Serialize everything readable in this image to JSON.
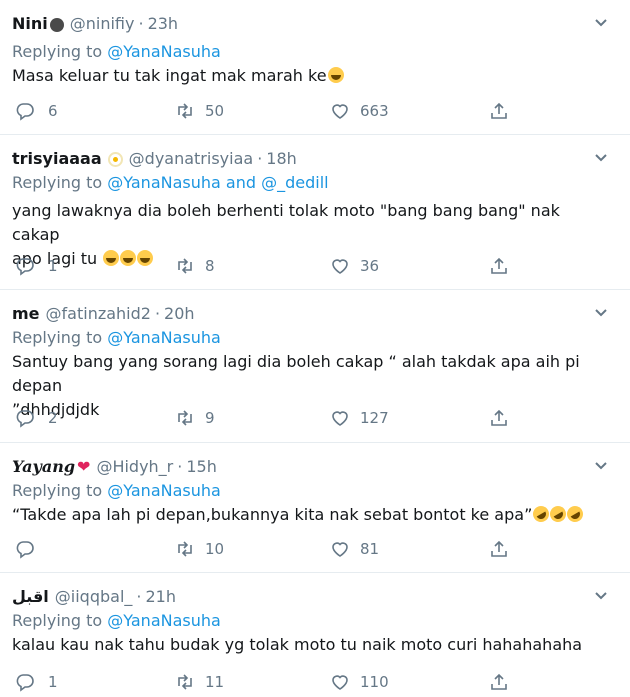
{
  "reply_prefix": "Replying to",
  "tweets": [
    {
      "name": "Nini",
      "handle": "@ninifiy",
      "separator": "·",
      "time": "23h",
      "mentions": "@YanaNasuha",
      "text": "Masa keluar tu tak ingat mak marah ke",
      "text2": "",
      "replies": "6",
      "retweets": "50",
      "likes": "663"
    },
    {
      "name": "trisyiaaaa",
      "handle": "@dyanatrisyiaa",
      "separator": "·",
      "time": "18h",
      "mentions": "@YanaNasuha and @_dedill",
      "text": "yang lawaknya dia boleh berhenti tolak moto \"bang bang bang\" nak cakap",
      "text2": "apo lagi tu",
      "replies": "1",
      "retweets": "8",
      "likes": "36"
    },
    {
      "name": "me",
      "handle": "@fatinzahid2",
      "separator": "·",
      "time": "20h",
      "mentions": "@YanaNasuha",
      "text": "Santuy bang yang sorang lagi dia boleh cakap “ alah takdak apa aih pi depan",
      "text2": "”dhhdjdjdk",
      "replies": "2",
      "retweets": "9",
      "likes": "127"
    },
    {
      "name": "Yayang",
      "handle": "@Hidyh_r",
      "separator": "·",
      "time": "15h",
      "mentions": "@YanaNasuha",
      "text": "“Takde apa lah pi depan,bukannya kita nak sebat bontot ke apa”",
      "text2": "",
      "replies": "",
      "retweets": "10",
      "likes": "81"
    },
    {
      "name": "اقبل",
      "handle": "@iiqqbal_",
      "separator": "·",
      "time": "21h",
      "mentions": "@YanaNasuha",
      "text": "kalau kau nak tahu budak yg tolak moto tu naik moto curi hahahahaha",
      "text2": "",
      "replies": "1",
      "retweets": "11",
      "likes": "110"
    }
  ],
  "icons": {
    "reply": "reply-icon",
    "retweet": "retweet-icon",
    "like": "like-icon",
    "share": "share-icon",
    "menu": "chevron-down-icon"
  },
  "colors": {
    "link": "#1b95e0",
    "muted": "#657786",
    "text": "#14171a",
    "divider": "#e6ecf0"
  }
}
